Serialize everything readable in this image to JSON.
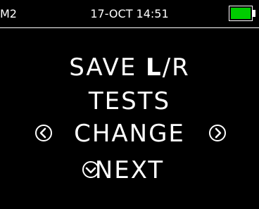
{
  "status": {
    "device_id": "M2",
    "datetime": "17-OCT 14:51",
    "battery_color": "#00cc00",
    "battery_level": 1.0
  },
  "menu": {
    "line1_pre": "SAVE ",
    "line1_bold": "L",
    "line1_post": "/R",
    "line2": "TESTS",
    "line3": "CHANGE",
    "line4": "NEXT"
  },
  "icons": {
    "left": "chevron-left-icon",
    "right": "chevron-right-icon",
    "down": "chevron-down-icon"
  }
}
